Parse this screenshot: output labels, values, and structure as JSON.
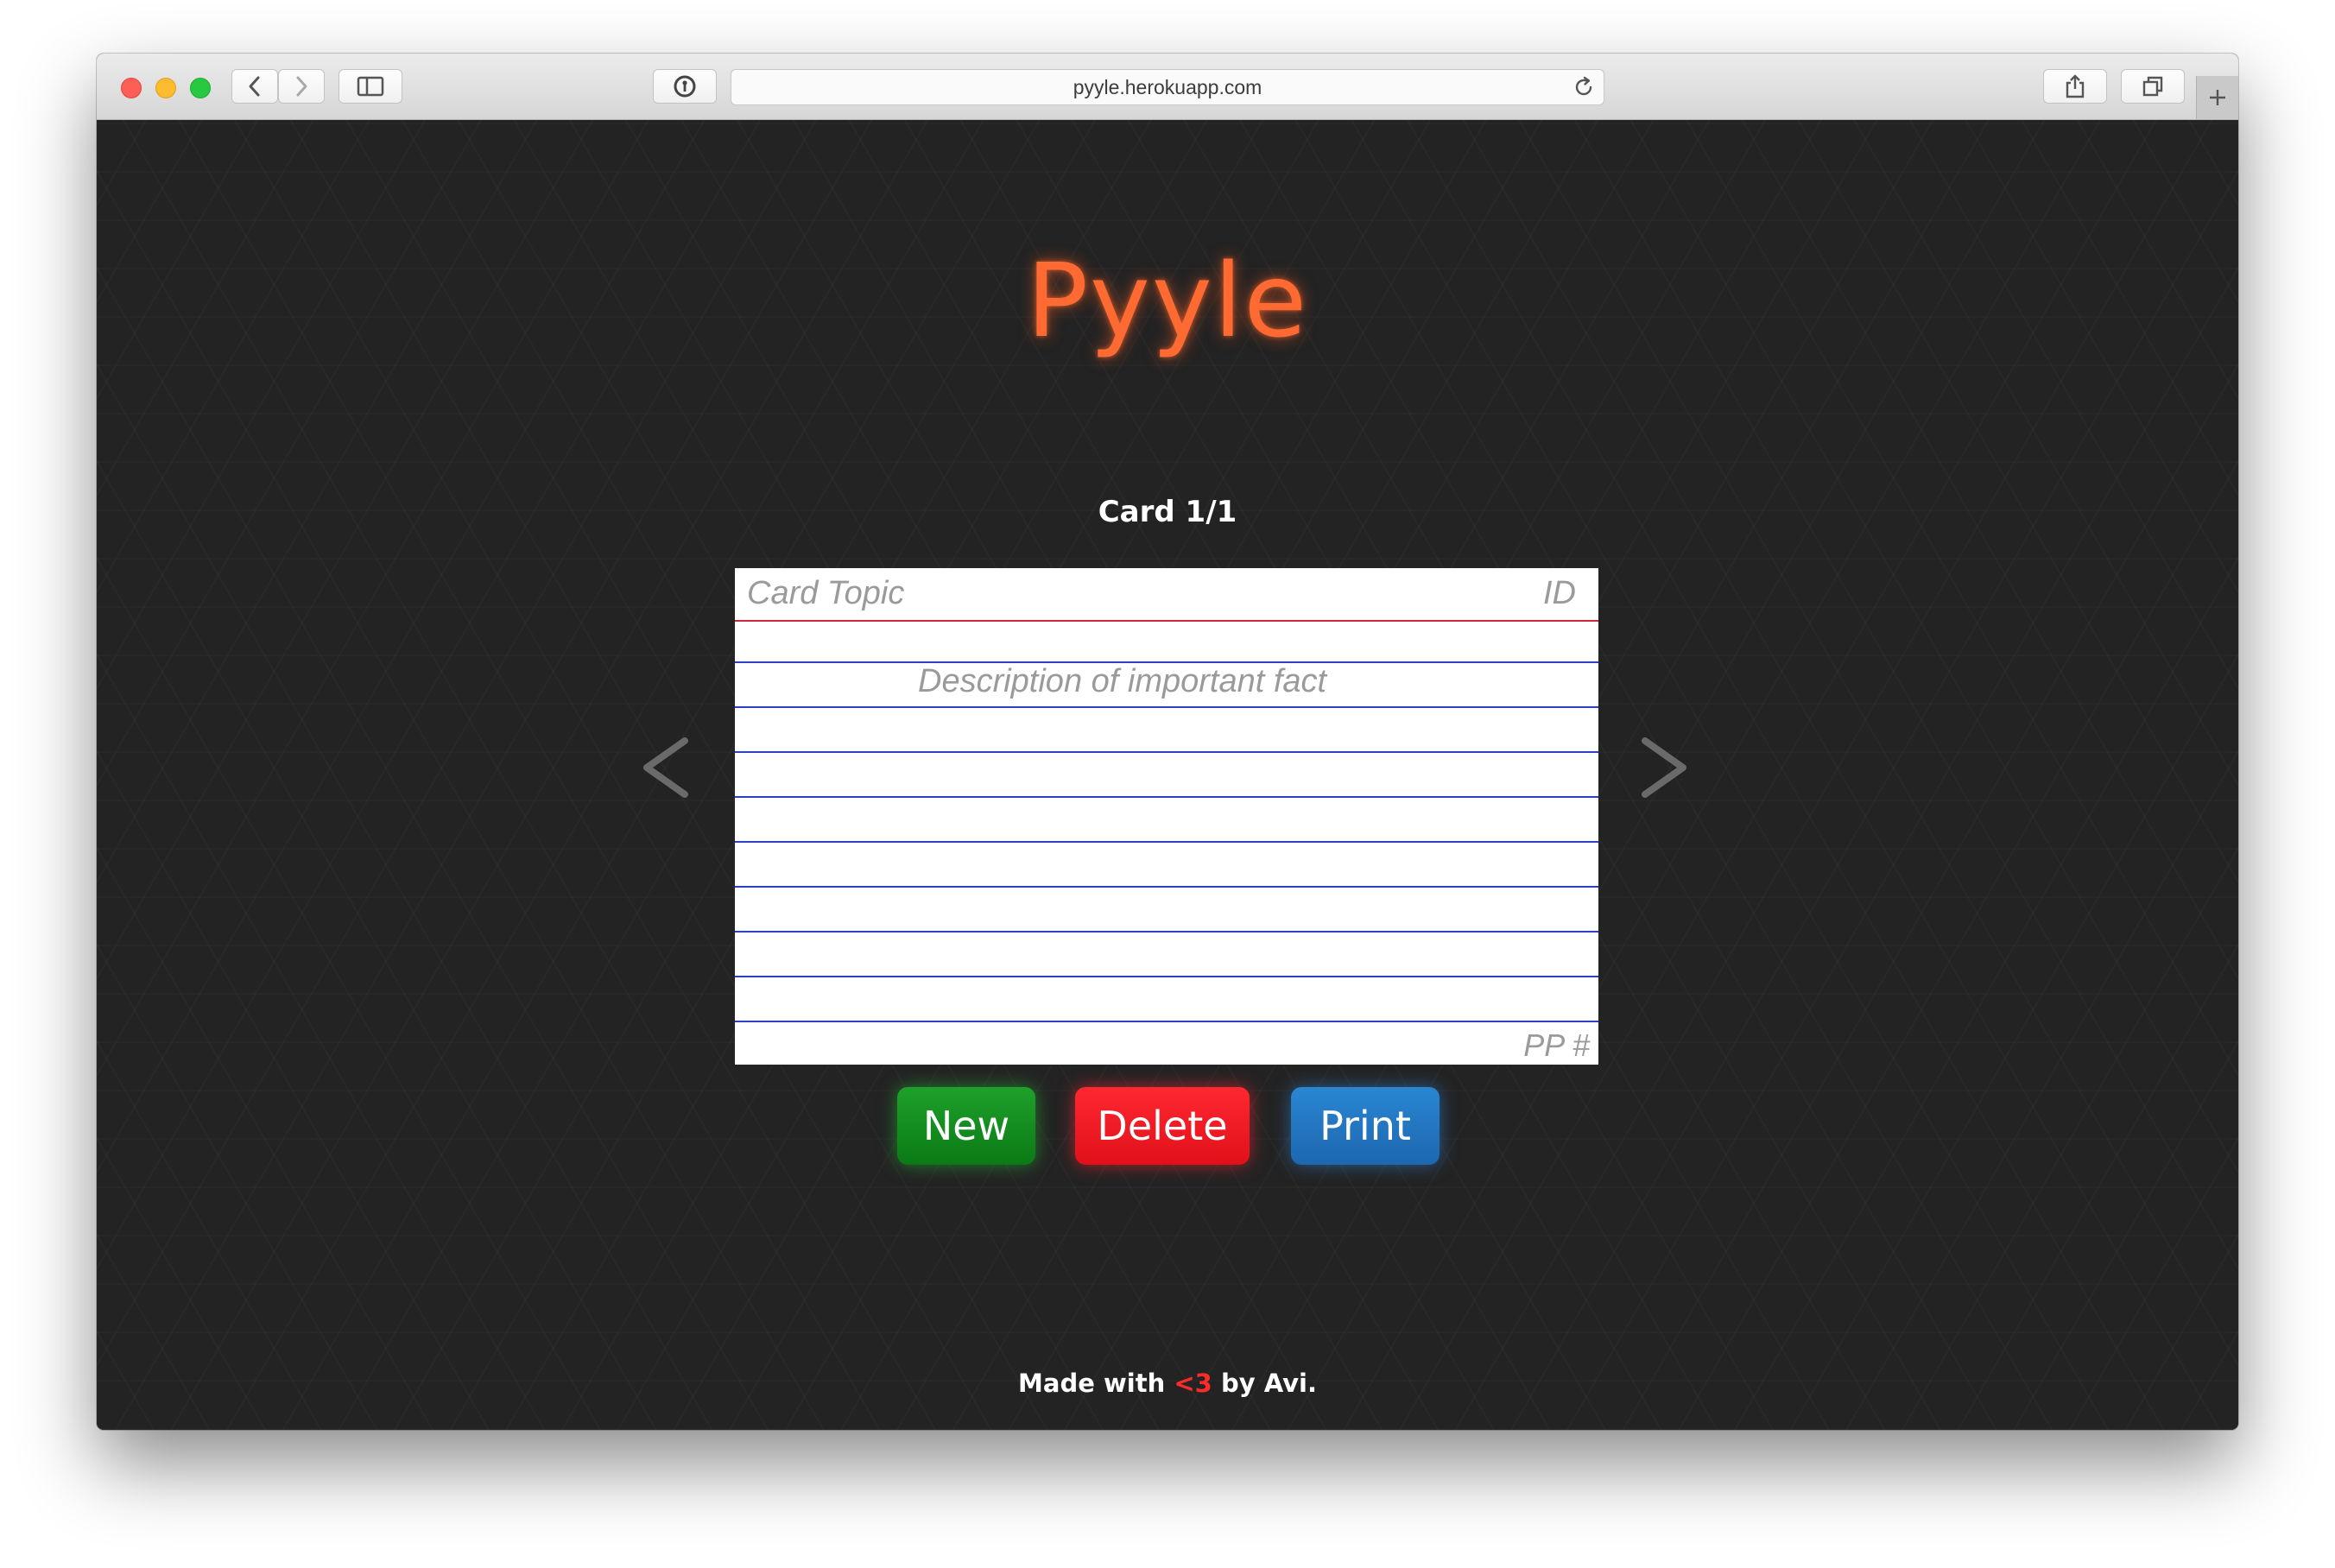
{
  "browser": {
    "url": "pyyle.herokuapp.com"
  },
  "app": {
    "title": "Pyyle",
    "counter": "Card 1/1"
  },
  "card": {
    "topic_placeholder": "Card Topic",
    "id_placeholder": "ID",
    "fact_placeholder": "Description of important fact",
    "page_placeholder": "PP #"
  },
  "nav": {
    "prev_icon": "chevron-left-icon",
    "next_icon": "chevron-right-icon"
  },
  "buttons": {
    "new_label": "New",
    "delete_label": "Delete",
    "print_label": "Print"
  },
  "footer": {
    "prefix": "Made with",
    "heart": "<3",
    "suffix": "by Avi."
  },
  "colors": {
    "logo": "#ff6a33",
    "new": "#139223",
    "delete": "#f01c24",
    "print": "#2477c2",
    "card_header_rule": "#d0263c",
    "card_rule": "#2b3fc7"
  }
}
